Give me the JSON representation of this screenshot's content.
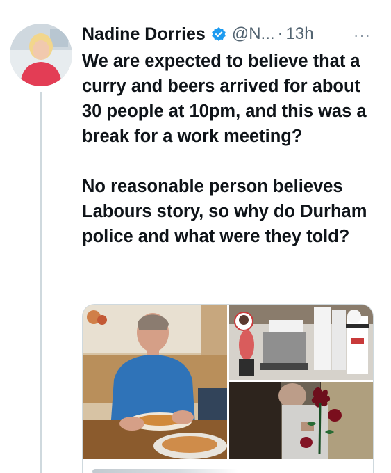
{
  "tweet": {
    "author_name": "Nadine Dorries",
    "handle": "@N...",
    "separator": "·",
    "timestamp": "13h",
    "verified": true,
    "more_label": "···",
    "text_paragraphs": [
      "We are expected to believe that a curry and beers arrived for about 30 people at 10pm, and this was a break for a work meeting?",
      "No reasonable person believes Labours story, so why do Durham police and what were they told?"
    ]
  },
  "colors": {
    "text": "#0f1419",
    "secondary_text": "#536471",
    "verified_badge": "#1d9bf0",
    "thread_line": "#cfd9de"
  },
  "icons": {
    "verified": "verified-badge-icon",
    "more": "more-options-icon"
  }
}
